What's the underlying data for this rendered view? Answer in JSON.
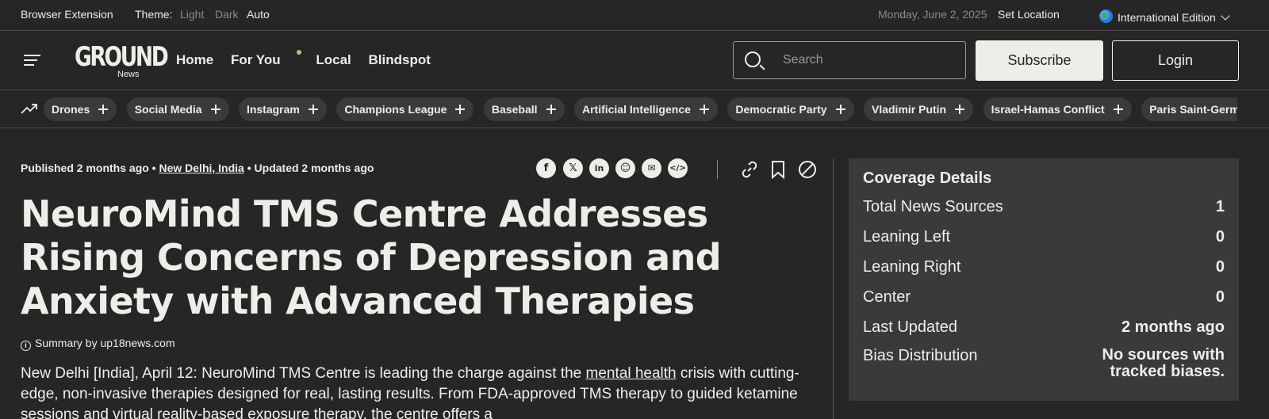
{
  "topbar": {
    "extension": "Browser Extension",
    "theme_label": "Theme:",
    "theme_light": "Light",
    "theme_dark": "Dark",
    "theme_auto": "Auto",
    "date": "Monday, June 2, 2025",
    "set_location": "Set Location",
    "edition": "International Edition"
  },
  "nav": {
    "logo_mark": "GROUND",
    "logo_sub": "News",
    "links": [
      "Home",
      "For You",
      "Local",
      "Blindspot"
    ],
    "search_placeholder": "Search",
    "subscribe": "Subscribe",
    "login": "Login"
  },
  "topics": [
    "Drones",
    "Social Media",
    "Instagram",
    "Champions League",
    "Baseball",
    "Artificial Intelligence",
    "Democratic Party",
    "Vladimir Putin",
    "Israel-Hamas Conflict",
    "Paris Saint-Germain"
  ],
  "article": {
    "published": "Published 2 months ago",
    "location": "New Delhi, India",
    "updated": "Updated 2 months ago",
    "title": "NeuroMind TMS Centre Addresses Rising Concerns of Depression and Anxiety with Advanced Therapies",
    "summary": "Summary by up18news.com",
    "body_pre": "New Delhi [India], April 12: NeuroMind TMS Centre is leading the charge against the ",
    "body_link": "mental health",
    "body_post": " crisis with cutting-edge, non-invasive therapies designed for real, lasting results. From FDA-approved TMS therapy to guided ketamine sessions and virtual reality-based exposure therapy, the centre offers a"
  },
  "share_icons": [
    "facebook-icon",
    "x-icon",
    "linkedin-icon",
    "reddit-icon",
    "email-icon",
    "embed-icon"
  ],
  "coverage": {
    "title": "Coverage Details",
    "rows": [
      {
        "label": "Total News Sources",
        "value": "1"
      },
      {
        "label": "Leaning Left",
        "value": "0"
      },
      {
        "label": "Leaning Right",
        "value": "0"
      },
      {
        "label": "Center",
        "value": "0"
      },
      {
        "label": "Last Updated",
        "value": "2 months ago"
      },
      {
        "label": "Bias Distribution",
        "value": "No sources with tracked biases."
      }
    ]
  }
}
